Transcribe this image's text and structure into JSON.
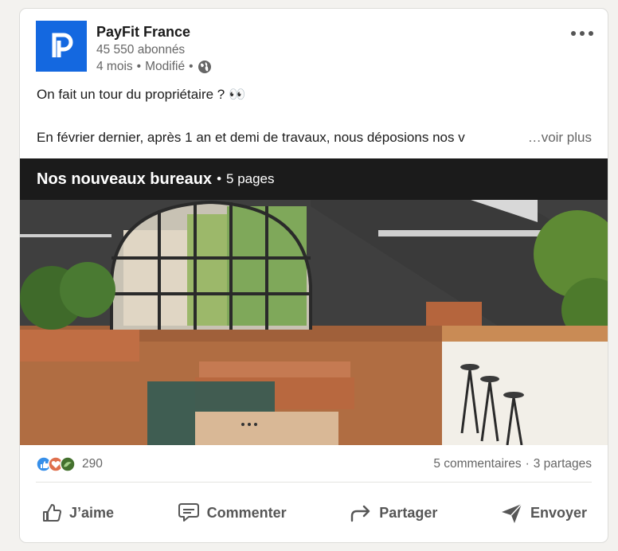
{
  "post": {
    "author": {
      "name": "PayFit France",
      "followers": "45 550 abonnés",
      "time": "4 mois",
      "edited": "Modifié",
      "dot": "•",
      "visibility_icon": "globe-icon",
      "logo_color": "#1468e0"
    },
    "menu_icon": "more-horizontal-icon",
    "text_line1": "On fait un tour du propriétaire ? 👀",
    "text_line2": "En février dernier, après 1 an et demi de travaux, nous déposions nos v",
    "see_more": "…voir plus",
    "document": {
      "title": "Nos nouveaux bureaux",
      "separator": "•",
      "pages": "5 pages"
    },
    "stats": {
      "reaction_icons": [
        "like-icon",
        "love-icon",
        "support-icon"
      ],
      "reactions_count": "290",
      "comments": "5 commentaires",
      "dot": "·",
      "shares": "3 partages"
    },
    "actions": [
      {
        "label": "J’aime",
        "icon": "thumbs-up-icon"
      },
      {
        "label": "Commenter",
        "icon": "comment-icon"
      },
      {
        "label": "Partager",
        "icon": "share-icon"
      },
      {
        "label": "Envoyer",
        "icon": "send-icon"
      }
    ]
  },
  "colors": {
    "brand_blue": "#1468e0",
    "muted_text": "#666666",
    "action_text": "#565656"
  }
}
